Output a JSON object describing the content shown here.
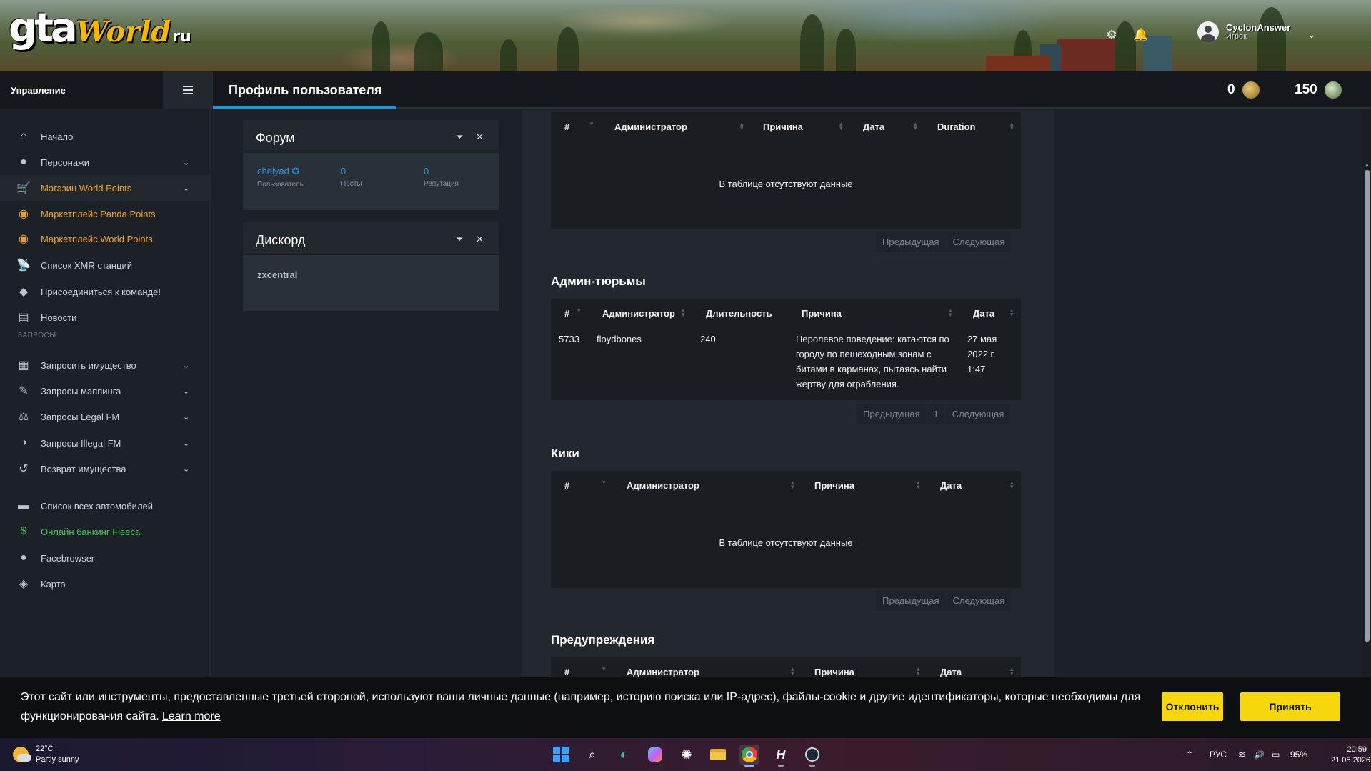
{
  "logo": {
    "gta": "gta",
    "world": "World",
    "ru": "ru"
  },
  "user": {
    "name": "CyclonAnswer",
    "role": "Игрок"
  },
  "page_title": "Профиль пользователя",
  "points": [
    {
      "value": "0",
      "icon": "rank-badge-icon",
      "color": "#c9a54a"
    },
    {
      "value": "150",
      "icon": "panda-coin-icon",
      "color": "#9fbf8a"
    }
  ],
  "sidebar": {
    "header": "Управление",
    "section_requests": "ЗАПРОСЫ",
    "items": [
      {
        "label": "Начало",
        "icon": "⌂",
        "name": "home",
        "chevron": false,
        "style": ""
      },
      {
        "label": "Персонажи",
        "icon": "●",
        "name": "characters",
        "chevron": true,
        "style": ""
      },
      {
        "label": "Магазин World Points",
        "icon": "🛒",
        "name": "world-points-shop",
        "chevron": true,
        "style": "gold active"
      },
      {
        "label": "Маркетплейс Panda Points",
        "icon": "◉",
        "name": "marketplace-panda-points",
        "chevron": false,
        "style": "gold"
      },
      {
        "label": "Маркетплейс World Points",
        "icon": "◉",
        "name": "marketplace-world-points",
        "chevron": false,
        "style": "gold"
      },
      {
        "label": "Список XMR станций",
        "icon": "📡",
        "name": "xmr-stations",
        "chevron": false,
        "style": ""
      },
      {
        "label": "Присоединиться к команде!",
        "icon": "◆",
        "name": "join-team",
        "chevron": false,
        "style": ""
      },
      {
        "label": "Новости",
        "icon": "▤",
        "name": "news",
        "chevron": false,
        "style": ""
      },
      {
        "label": "Запросить имущество",
        "icon": "▦",
        "name": "request-property",
        "chevron": true,
        "style": ""
      },
      {
        "label": "Запросы маппинга",
        "icon": "✎",
        "name": "mapping-requests",
        "chevron": true,
        "style": ""
      },
      {
        "label": "Запросы Legal FM",
        "icon": "⚖",
        "name": "legal-fm-requests",
        "chevron": true,
        "style": ""
      },
      {
        "label": "Запросы Illegal FM",
        "icon": "◑",
        "name": "illegal-fm-requests",
        "chevron": true,
        "style": ""
      },
      {
        "label": "Возврат имущества",
        "icon": "↺",
        "name": "property-refund",
        "chevron": true,
        "style": ""
      },
      {
        "label": "Список всех автомобилей",
        "icon": "▬",
        "name": "vehicles-list",
        "chevron": false,
        "style": ""
      },
      {
        "label": "Онлайн банкинг Fleeca",
        "icon": "$",
        "name": "fleeca-banking",
        "chevron": false,
        "style": "green"
      },
      {
        "label": "Facebrowser",
        "icon": "●",
        "name": "facebrowser",
        "chevron": false,
        "style": ""
      },
      {
        "label": "Карта",
        "icon": "◈",
        "name": "map",
        "chevron": false,
        "style": ""
      }
    ]
  },
  "forum": {
    "title": "Форум",
    "user": "chelyad",
    "user_label": "Пользователь",
    "posts": "0",
    "posts_label": "Посты",
    "rep": "0",
    "rep_label": "Репутация"
  },
  "discord": {
    "title": "Дискорд",
    "value": "zxcentral"
  },
  "bans_table": {
    "headers": [
      "#",
      "Администратор",
      "Причина",
      "Дата",
      "Duration"
    ],
    "empty": "В таблице отсутствуют данные",
    "prev": "Предыдущая",
    "next": "Следующая"
  },
  "jails": {
    "title": "Админ-тюрьмы",
    "headers": [
      "#",
      "Администратор",
      "Длительность",
      "Причина",
      "Дата"
    ],
    "row": {
      "id": "5733",
      "admin": "floydbones",
      "duration": "240",
      "reason": "Неролевое поведение: катаются по городу по пешеходным зонам с битами в карманах, пытаясь найти жертву для ограбления.",
      "date": "27 мая 2022 г. 1:47"
    },
    "prev": "Предыдущая",
    "page": "1",
    "next": "Следующая"
  },
  "kicks": {
    "title": "Кики",
    "headers": [
      "#",
      "Администратор",
      "Причина",
      "Дата"
    ],
    "empty": "В таблице отсутствуют данные",
    "prev": "Предыдущая",
    "next": "Следующая"
  },
  "warnings": {
    "title": "Предупреждения",
    "headers": [
      "#",
      "Администратор",
      "Причина",
      "Дата"
    ]
  },
  "cookie": {
    "text": "Этот сайт или инструменты, предоставленные третьей стороной, используют ваши личные данные (например, историю поиска или IP-адрес), файлы-cookie и другие идентификаторы, которые необходимы для функционирования сайта.",
    "learn_more": "Learn more",
    "decline": "Отклонить",
    "accept": "Принять"
  },
  "taskbar": {
    "temp": "22°C",
    "weather": "Partly sunny",
    "lang": "РУС",
    "battery": "95%",
    "time": "20:59",
    "date": "21.05.2026"
  }
}
